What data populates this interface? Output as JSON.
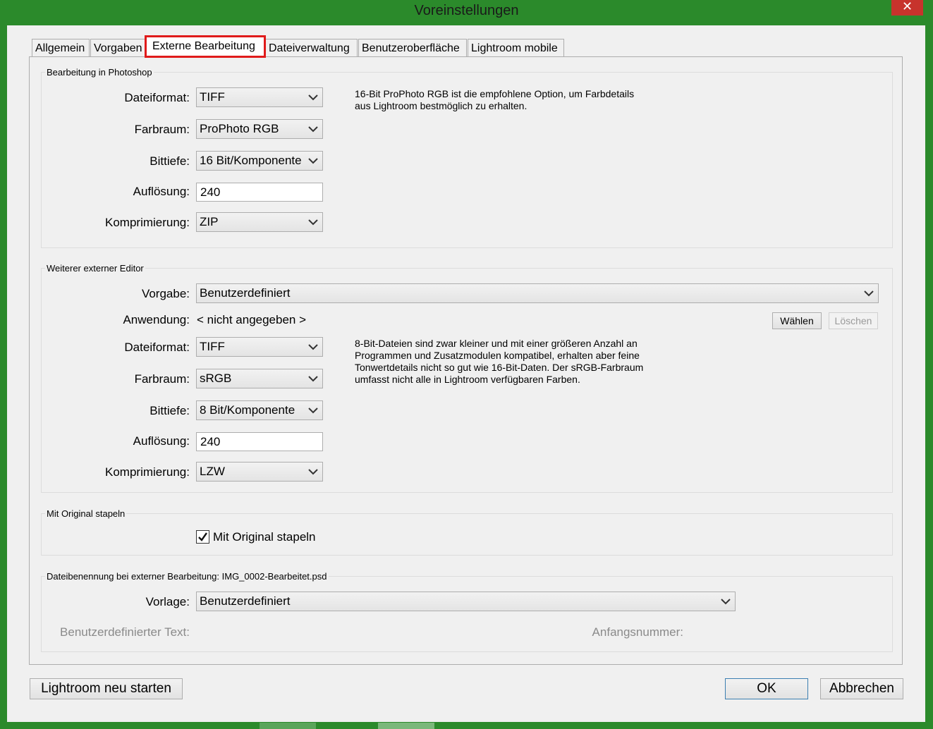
{
  "window": {
    "title": "Voreinstellungen",
    "close_glyph": "✕"
  },
  "tabs": [
    "Allgemein",
    "Vorgaben",
    "Externe Bearbeitung",
    "Dateiverwaltung",
    "Benutzeroberfläche",
    "Lightroom mobile"
  ],
  "photoshop": {
    "group_title": "Bearbeitung in Photoshop",
    "labels": {
      "dateiformat": "Dateiformat:",
      "farbraum": "Farbraum:",
      "bittiefe": "Bittiefe:",
      "aufloesung": "Auflösung:",
      "komprimierung": "Komprimierung:"
    },
    "values": {
      "dateiformat": "TIFF",
      "farbraum": "ProPhoto RGB",
      "bittiefe": "16 Bit/Komponente",
      "aufloesung": "240",
      "komprimierung": "ZIP"
    },
    "note": "16-Bit ProPhoto RGB ist die empfohlene Option, um Farbdetails aus Lightroom bestmöglich zu erhalten."
  },
  "editor": {
    "group_title": "Weiterer externer Editor",
    "labels": {
      "vorgabe": "Vorgabe:",
      "anwendung": "Anwendung:",
      "dateiformat": "Dateiformat:",
      "farbraum": "Farbraum:",
      "bittiefe": "Bittiefe:",
      "aufloesung": "Auflösung:",
      "komprimierung": "Komprimierung:"
    },
    "values": {
      "vorgabe": "Benutzerdefiniert",
      "anwendung": "< nicht angegeben >",
      "dateiformat": "TIFF",
      "farbraum": "sRGB",
      "bittiefe": "8 Bit/Komponente",
      "aufloesung": "240",
      "komprimierung": "LZW"
    },
    "buttons": {
      "waehlen": "Wählen",
      "loeschen": "Löschen"
    },
    "note": "8-Bit-Dateien sind zwar kleiner und mit einer größeren Anzahl an Programmen und Zusatzmodulen kompatibel, erhalten aber feine Tonwertdetails nicht so gut wie 16-Bit-Daten. Der sRGB-Farbraum umfasst nicht alle in Lightroom verfügbaren Farben."
  },
  "stack": {
    "group_title": "Mit Original stapeln",
    "checkbox_label": "Mit Original stapeln",
    "checked": true
  },
  "naming": {
    "group_title": "Dateibenennung bei externer Bearbeitung: IMG_0002-Bearbeitet.psd",
    "labels": {
      "vorlage": "Vorlage:",
      "custom_text": "Benutzerdefinierter Text:",
      "start_number": "Anfangsnummer:"
    },
    "values": {
      "vorlage": "Benutzerdefiniert"
    }
  },
  "footer": {
    "restart": "Lightroom neu starten",
    "ok": "OK",
    "cancel": "Abbrechen"
  },
  "colors": {
    "titlebar": "#2b8a2b",
    "close": "#c7332c",
    "highlight": "#e01b1b"
  }
}
